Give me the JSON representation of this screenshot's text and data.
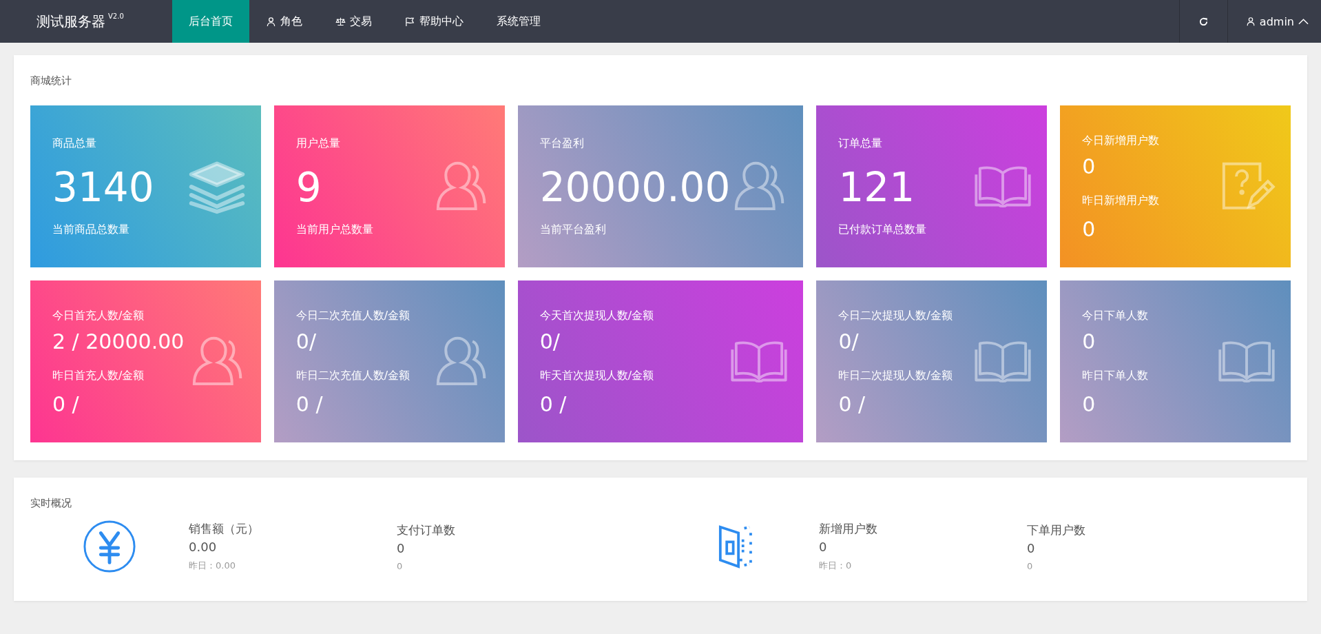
{
  "brand": {
    "name": "测试服务器",
    "version": "V2.0"
  },
  "nav": [
    {
      "label": "后台首页",
      "selected": true
    },
    {
      "label": "角色",
      "selected": false
    },
    {
      "label": "交易",
      "selected": false
    },
    {
      "label": "帮助中心",
      "selected": false
    },
    {
      "label": "系统管理",
      "selected": false
    }
  ],
  "user": {
    "name": "admin"
  },
  "mall_stats": {
    "title": "商城统计",
    "cards": [
      {
        "kind": "single",
        "title": "商品总量",
        "value": "3140",
        "subtitle": "当前商品总数量"
      },
      {
        "kind": "single",
        "title": "用户总量",
        "value": "9",
        "subtitle": "当前用户总数量"
      },
      {
        "kind": "single",
        "title": "平台盈利",
        "value": "20000.00",
        "subtitle": "当前平台盈利"
      },
      {
        "kind": "single",
        "title": "订单总量",
        "value": "121",
        "subtitle": "已付款订单总数量"
      },
      {
        "kind": "double",
        "title": "今日新增用户数",
        "value": "0",
        "title_2": "昨日新增用户数",
        "value_2": "0"
      },
      {
        "kind": "double",
        "title": "今日首充人数/金额",
        "value": "2 / 20000.00",
        "title_2": "昨日首充人数/金额",
        "value_2": "0 /"
      },
      {
        "kind": "double",
        "title": "今日二次充值人数/金额",
        "value": "0/",
        "title_2": "昨日二次充值人数/金额",
        "value_2": "0 /"
      },
      {
        "kind": "double",
        "title": "今天首次提现人数/金额",
        "value": "0/",
        "title_2": "昨天首次提现人数/金额",
        "value_2": "0 /"
      },
      {
        "kind": "double",
        "title": "今日二次提现人数/金额",
        "value": "0/",
        "title_2": "昨日二次提现人数/金额",
        "value_2": "0 /"
      },
      {
        "kind": "double",
        "title": "今日下单人数",
        "value": "0",
        "title_2": "昨日下单人数",
        "value_2": "0"
      }
    ]
  },
  "realtime": {
    "title": "实时概况",
    "groups": [
      {
        "stats": [
          {
            "label": "销售额（元）",
            "value": "0.00",
            "sub": "昨日：0.00"
          },
          {
            "label": "支付订单数",
            "value": "0",
            "sub": "0"
          }
        ]
      },
      {
        "stats": [
          {
            "label": "新增用户数",
            "value": "0",
            "sub": "昨日：0"
          },
          {
            "label": "下单用户数",
            "value": "0",
            "sub": "0"
          }
        ]
      }
    ]
  }
}
